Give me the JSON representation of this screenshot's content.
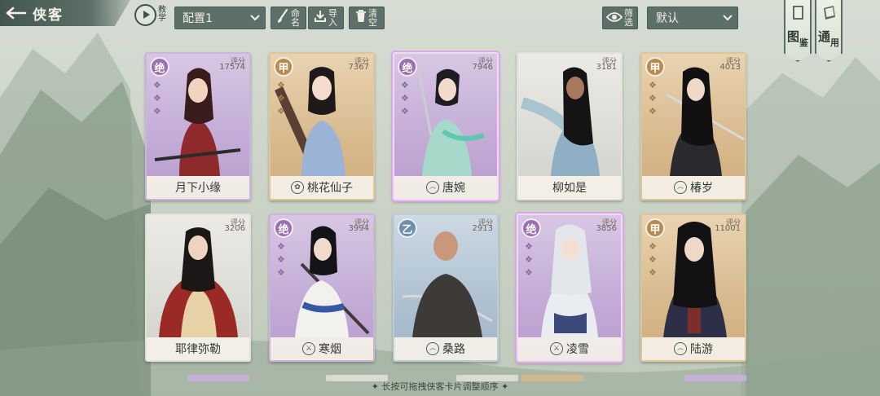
{
  "header": {
    "back_title": "侠客",
    "tutorial_label": "教学",
    "preset_value": "配置1",
    "rename_label": "命名",
    "import_label": "导入",
    "clear_label": "清空",
    "filter_label": "筛选",
    "sort_value": "默认",
    "codex_main": "图",
    "codex_sub": "鉴",
    "general_main": "通",
    "general_sub": "用"
  },
  "cards": [
    {
      "name": "月下小缘",
      "score_label": "评分",
      "score": "17574",
      "rank": "绝",
      "tier": "purple",
      "school": "",
      "selected": false
    },
    {
      "name": "桃花仙子",
      "score_label": "评分",
      "score": "7367",
      "rank": "甲",
      "tier": "gold",
      "school": "lotus",
      "selected": false
    },
    {
      "name": "唐婉",
      "score_label": "评分",
      "score": "7946",
      "rank": "绝",
      "tier": "purple",
      "school": "swirl",
      "selected": true
    },
    {
      "name": "柳如是",
      "score_label": "评分",
      "score": "3181",
      "rank": "",
      "tier": "grey",
      "school": "",
      "selected": false
    },
    {
      "name": "椿岁",
      "score_label": "评分",
      "score": "4013",
      "rank": "甲",
      "tier": "gold",
      "school": "swirl",
      "selected": false
    },
    {
      "name": "耶律弥勒",
      "score_label": "评分",
      "score": "3206",
      "rank": "",
      "tier": "grey",
      "school": "",
      "selected": false
    },
    {
      "name": "寒烟",
      "score_label": "评分",
      "score": "3994",
      "rank": "绝",
      "tier": "purple",
      "school": "blade",
      "selected": false
    },
    {
      "name": "桑路",
      "score_label": "评分",
      "score": "2913",
      "rank": "乙",
      "tier": "blue",
      "school": "swirl",
      "selected": false
    },
    {
      "name": "凌雪",
      "score_label": "评分",
      "score": "3856",
      "rank": "绝",
      "tier": "purple",
      "school": "blade",
      "selected": true
    },
    {
      "name": "陆游",
      "score_label": "评分",
      "score": "11001",
      "rank": "甲",
      "tier": "gold",
      "school": "swirl",
      "selected": false
    }
  ],
  "footer": {
    "tip": "✦ 长按可拖拽侠客卡片调整顺序 ✦"
  },
  "colors": {
    "purple_tier": "#c3abd6",
    "gold_tier": "#d8b98d",
    "blue_tier": "#aec1d1",
    "grey_tier": "#dcdcd6",
    "button_dark": "#5d6f69"
  }
}
